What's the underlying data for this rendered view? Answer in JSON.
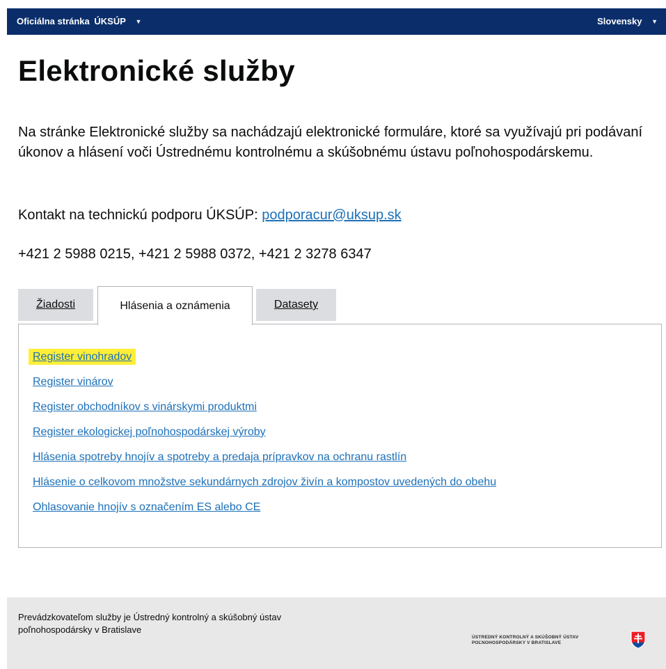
{
  "topbar": {
    "official_prefix": "Oficiálna stránka",
    "brand": "ÚKSÚP",
    "language": "Slovensky"
  },
  "page": {
    "title": "Elektronické služby",
    "intro": "Na stránke Elektronické služby sa nachádzajú elektronické formuláre, ktoré sa využívajú pri podávaní úkonov a hlásení voči Ústrednému kontrolnému a skúšobnému ústavu poľnohospodárskemu.",
    "contact_label": "Kontakt na technickú podporu ÚKSÚP:",
    "contact_email": "podporacur@uksup.sk",
    "phones": "+421 2 5988 0215, +421 2 5988 0372, +421 2 3278 6347"
  },
  "tabs": [
    {
      "label": "Žiadosti",
      "active": false
    },
    {
      "label": "Hlásenia a oznámenia",
      "active": true
    },
    {
      "label": "Datasety",
      "active": false
    }
  ],
  "links": [
    "Register vinohradov",
    "Register vinárov",
    "Register obchodníkov s vinárskymi produktmi",
    "Register ekologickej poľnohospodárskej výroby",
    "Hlásenia spotreby hnojív a spotreby a predaja prípravkov na ochranu rastlín",
    "Hlásenie o celkovom množstve sekundárnych zdrojov živín a kompostov uvedených do obehu",
    "Ohlasovanie hnojív s označením ES alebo CE"
  ],
  "footer": {
    "text_line1": "Prevádzkovateľom služby je Ústredný kontrolný a skúšobný ústav",
    "text_line2": "poľnohospodársky v Bratislave",
    "logo_line1": "ÚSTREDNÝ KONTROLNÝ A SKÚŠOBNÝ ÚSTAV",
    "logo_line2": "POĽNOHOSPODÁRSKY V BRATISLAVE"
  },
  "colors": {
    "topbar": "#0b2e6b",
    "link": "#1d70b8",
    "highlight": "#ffee38",
    "tab_inactive": "#dcdde0",
    "footer": "#e8e8e8"
  }
}
